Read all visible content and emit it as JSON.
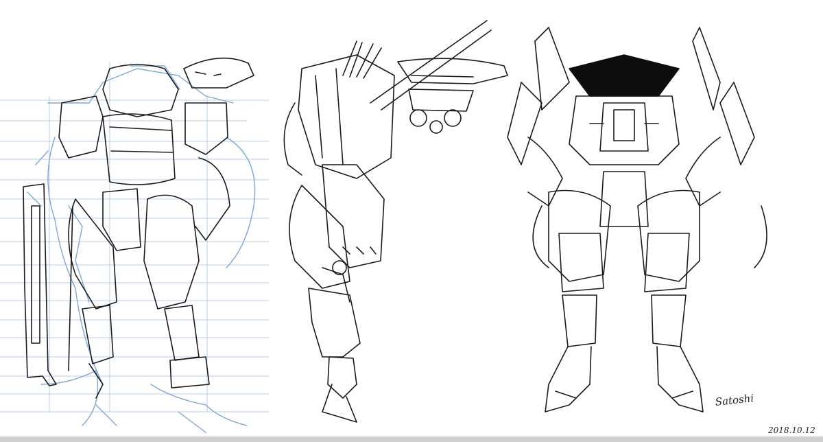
{
  "artwork": {
    "signature": "Satoshi",
    "date": "2018.10.12"
  },
  "colors": {
    "background": "#ffffff",
    "ink": "#1a1a1a",
    "sketch_blue": "#7fa6d6",
    "guide_blue": "#b9cde8",
    "shadow_black": "#0d0d0d",
    "bottom_bar": "#cfcfcf"
  }
}
